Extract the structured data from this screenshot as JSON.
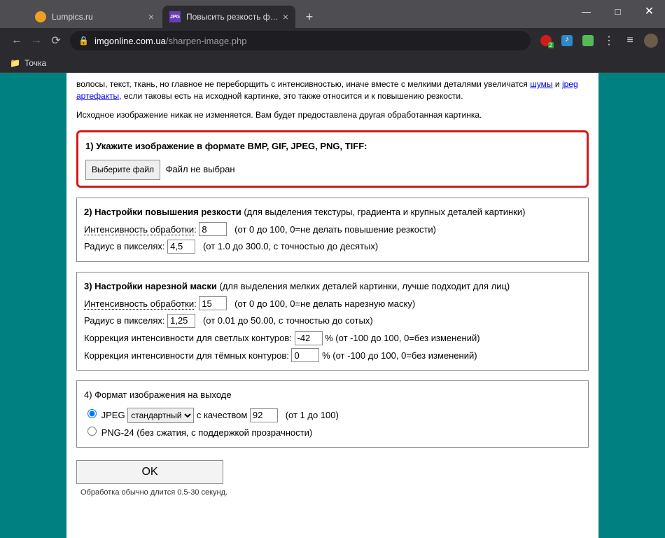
{
  "window": {
    "tabs": [
      {
        "title": "Lumpics.ru",
        "favicon_color": "#f0a020"
      },
      {
        "title": "Повысить резкость фото и нар…",
        "favicon_text": "JPG",
        "favicon_bg": "#6a3db8"
      }
    ],
    "url_host": "imgonline.com.ua",
    "url_path": "/sharpen-image.php"
  },
  "bookmarks": {
    "item1": "Точка"
  },
  "intro": {
    "line1a": "волосы, текст, ткань, но главное не переборщить с интенсивностью, иначе вместе с мелкими деталями увеличатся ",
    "link1": "шумы",
    "line1b": " и ",
    "link2": "jpeg артефакты",
    "line1c": ", если таковы есть на исходной картинке, это также относится и к повышению резкости.",
    "line2": "Исходное изображение никак не изменяется. Вам будет предоставлена другая обработанная картинка."
  },
  "section1": {
    "title": "1) Укажите изображение в формате BMP, GIF, JPEG, PNG, TIFF:",
    "file_button": "Выберите файл",
    "file_status": "Файл не выбран"
  },
  "section2": {
    "title": "2) Настройки повышения резкости",
    "subtitle": " (для выделения текстуры, градиента и крупных деталей картинки)",
    "intensity_label": "Интенсивность обработки",
    "intensity_value": "8",
    "intensity_hint": "(от 0 до 100, 0=не делать повышение резкости)",
    "radius_label": "Радиус в пикселях:",
    "radius_value": "4,5",
    "radius_hint": "(от 1.0 до 300.0, с точностью до десятых)"
  },
  "section3": {
    "title": "3) Настройки нарезной маски",
    "subtitle": " (для выделения мелких деталей картинки, лучше подходит для лиц)",
    "intensity_label": "Интенсивность обработки",
    "intensity_value": "15",
    "intensity_hint": "(от 0 до 100, 0=не делать нарезную маску)",
    "radius_label": "Радиус в пикселях:",
    "radius_value": "1,25",
    "radius_hint": "(от 0.01 до 50.00, с точностью до сотых)",
    "light_label": "Коррекция интенсивности для светлых контуров:",
    "light_value": "-42",
    "light_hint": "% (от -100 до 100, 0=без изменений)",
    "dark_label": "Коррекция интенсивности для тёмных контуров:",
    "dark_value": "0",
    "dark_hint": "% (от -100 до 100, 0=без изменений)"
  },
  "section4": {
    "title": "4) Формат изображения на выходе",
    "jpeg_label": "JPEG",
    "jpeg_select_value": "стандартный",
    "quality_label": " с качеством ",
    "quality_value": "92",
    "quality_hint": "(от 1 до 100)",
    "png_label": "PNG-24 (без сжатия, с поддержкой прозрачности)"
  },
  "submit": {
    "button": "OK",
    "note": "Обработка обычно длится 0.5-30 секунд."
  }
}
